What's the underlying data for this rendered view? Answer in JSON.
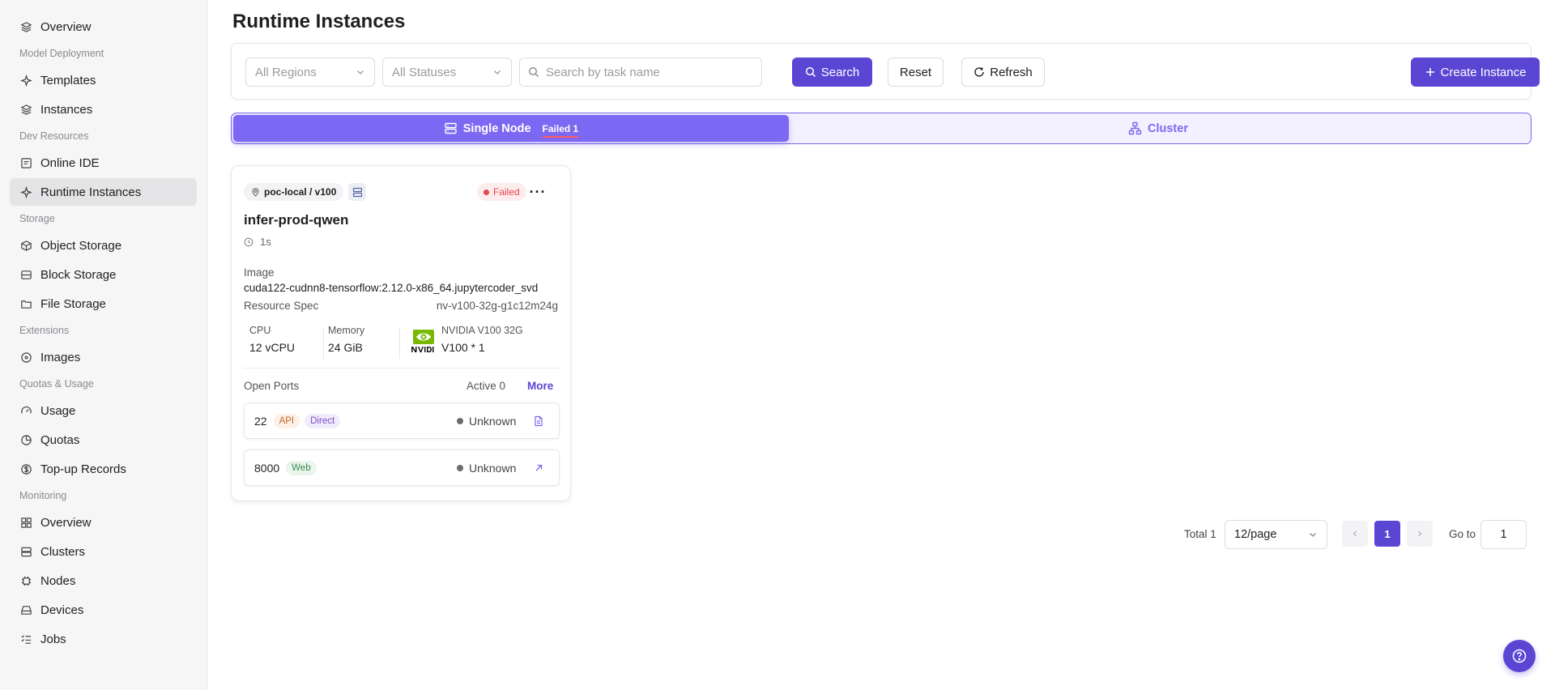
{
  "sidebar": {
    "items": [
      {
        "type": "item",
        "label": "Overview",
        "icon": "layers-icon"
      },
      {
        "type": "section",
        "label": "Model Deployment"
      },
      {
        "type": "item",
        "label": "Templates",
        "icon": "sparkle-icon"
      },
      {
        "type": "item",
        "label": "Instances",
        "icon": "layers-icon"
      },
      {
        "type": "section",
        "label": "Dev Resources"
      },
      {
        "type": "item",
        "label": "Online IDE",
        "icon": "ide-icon"
      },
      {
        "type": "item",
        "label": "Runtime Instances",
        "icon": "sparkle-icon",
        "active": true
      },
      {
        "type": "section",
        "label": "Storage"
      },
      {
        "type": "item",
        "label": "Object Storage",
        "icon": "cube-icon"
      },
      {
        "type": "item",
        "label": "Block Storage",
        "icon": "block-icon"
      },
      {
        "type": "item",
        "label": "File Storage",
        "icon": "folder-icon"
      },
      {
        "type": "section",
        "label": "Extensions"
      },
      {
        "type": "item",
        "label": "Images",
        "icon": "disc-icon"
      },
      {
        "type": "section",
        "label": "Quotas & Usage"
      },
      {
        "type": "item",
        "label": "Usage",
        "icon": "gauge-icon"
      },
      {
        "type": "item",
        "label": "Quotas",
        "icon": "pie-icon"
      },
      {
        "type": "item",
        "label": "Top-up Records",
        "icon": "dollar-icon"
      },
      {
        "type": "section",
        "label": "Monitoring"
      },
      {
        "type": "item",
        "label": "Overview",
        "icon": "grid-icon"
      },
      {
        "type": "item",
        "label": "Clusters",
        "icon": "server-icon"
      },
      {
        "type": "item",
        "label": "Nodes",
        "icon": "chip-icon"
      },
      {
        "type": "item",
        "label": "Devices",
        "icon": "drive-icon"
      },
      {
        "type": "item",
        "label": "Jobs",
        "icon": "list-check-icon"
      }
    ]
  },
  "page": {
    "title": "Runtime Instances"
  },
  "filters": {
    "region_placeholder": "All Regions",
    "status_placeholder": "All Statuses",
    "search_placeholder": "Search by task name",
    "search_label": "Search",
    "reset_label": "Reset",
    "refresh_label": "Refresh",
    "create_label": "Create Instance"
  },
  "tabs": {
    "single_label": "Single Node",
    "single_badge": "Failed 1",
    "cluster_label": "Cluster"
  },
  "card": {
    "location": "poc-local / v100",
    "status": "Failed",
    "name": "infer-prod-qwen",
    "age": "1s",
    "image_label": "Image",
    "image_value": "cuda122-cudnn8-tensorflow:2.12.0-x86_64.jupytercoder_svd",
    "spec_label": "Resource Spec",
    "spec_value": "nv-v100-32g-g1c12m24g",
    "cpu_label": "CPU",
    "cpu_value": "12  vCPU",
    "mem_label": "Memory",
    "mem_value": "24  GiB",
    "gpu_model": "NVIDIA V100 32G",
    "gpu_count": "V100  *  1",
    "ports_label": "Open Ports",
    "ports_active": "Active 0",
    "ports_more": "More",
    "ports": [
      {
        "port": "22",
        "tags": [
          "API",
          "Direct"
        ],
        "status": "Unknown",
        "action_icon": "document-icon"
      },
      {
        "port": "8000",
        "tags": [
          "Web"
        ],
        "status": "Unknown",
        "action_icon": "external-link-icon"
      }
    ]
  },
  "pagination": {
    "total": "Total 1",
    "page_size": "12/page",
    "current": "1",
    "goto_label": "Go to",
    "goto_value": "1"
  },
  "colors": {
    "primary": "#5b46d4",
    "tab_active": "#7c68f2",
    "failed": "#e5484d"
  }
}
